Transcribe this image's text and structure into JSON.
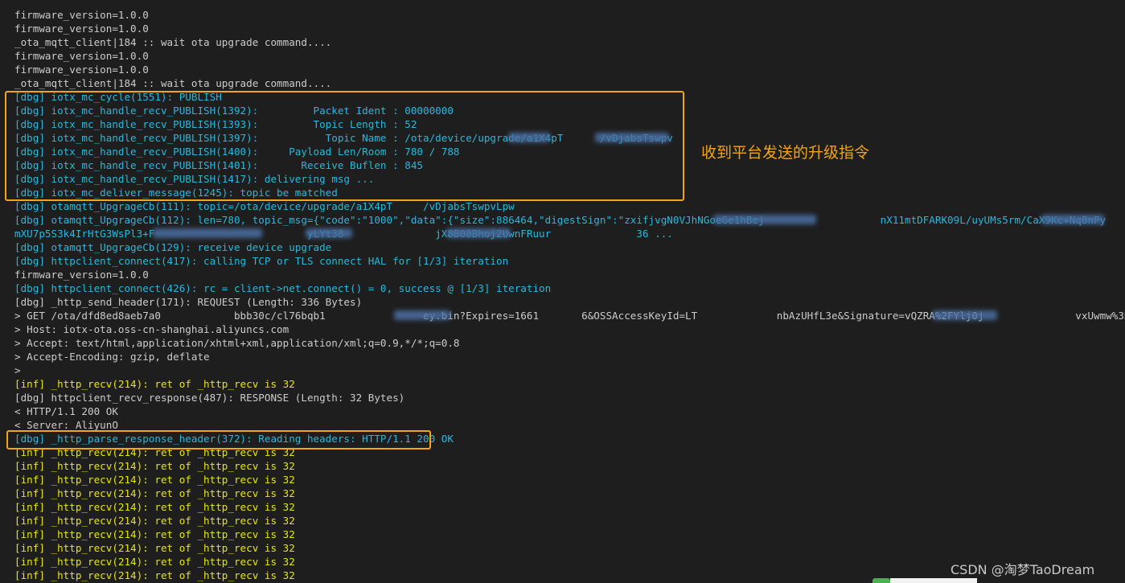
{
  "terminal": {
    "lines": [
      {
        "text": "firmware_version=1.0.0",
        "color": "white"
      },
      {
        "text": "firmware_version=1.0.0",
        "color": "white"
      },
      {
        "text": "_ota_mqtt_client|184 :: wait ota upgrade command....",
        "color": "white"
      },
      {
        "text": "firmware_version=1.0.0",
        "color": "white"
      },
      {
        "text": "firmware_version=1.0.0",
        "color": "white"
      },
      {
        "text": "_ota_mqtt_client|184 :: wait ota upgrade command....",
        "color": "white"
      },
      {
        "text": "[dbg] iotx_mc_cycle(1551): PUBLISH",
        "color": "cyan"
      },
      {
        "text": "[dbg] iotx_mc_handle_recv_PUBLISH(1392):         Packet Ident : 00000000",
        "color": "cyan"
      },
      {
        "text": "[dbg] iotx_mc_handle_recv_PUBLISH(1393):         Topic Length : 52",
        "color": "cyan"
      },
      {
        "text": "[dbg] iotx_mc_handle_recv_PUBLISH(1397):           Topic Name : /ota/device/upgrade/a1X4pT      /vDjabsTswpv",
        "color": "cyan"
      },
      {
        "text": "[dbg] iotx_mc_handle_recv_PUBLISH(1400):     Payload Len/Room : 780 / 788",
        "color": "cyan"
      },
      {
        "text": "[dbg] iotx_mc_handle_recv_PUBLISH(1401):       Receive Buflen : 845",
        "color": "cyan"
      },
      {
        "text": "[dbg] iotx_mc_handle_recv_PUBLISH(1417): delivering msg ...",
        "color": "cyan"
      },
      {
        "text": "[dbg] iotx_mc_deliver_message(1245): topic be matched",
        "color": "cyan"
      },
      {
        "text": "[dbg] otamqtt_UpgrageCb(111): topic=/ota/device/upgrade/a1X4pT     /vDjabsTswpvLpw",
        "color": "cyan"
      },
      {
        "text": "[dbg] otamqtt_UpgrageCb(112): len=780, topic_msg={\"code\":\"1000\",\"data\":{\"size\":886464,\"digestSign\":\"zxifjvgN0VJhNGoeGe1hBej                   nX11mtDFARK09L/uyUMs5rm/CaX9Kc+Nq8nPy              3N/PB6mk8",
        "color": "cyan"
      },
      {
        "text": "mXU7p5S3k4IrHtG3WsPl3+F                         yLYt38               jX8B08Bhoj2UwnFRuur              36 ...",
        "color": "cyan"
      },
      {
        "text": "[dbg] otamqtt_UpgrageCb(129): receive device upgrade",
        "color": "cyan"
      },
      {
        "text": "[dbg] httpclient_connect(417): calling TCP or TLS connect HAL for [1/3] iteration",
        "color": "cyan"
      },
      {
        "text": "firmware_version=1.0.0",
        "color": "white"
      },
      {
        "text": "[dbg] httpclient_connect(426): rc = client->net.connect() = 0, success @ [1/3] iteration",
        "color": "cyan"
      },
      {
        "text": "[dbg] _http_send_header(171): REQUEST (Length: 336 Bytes)",
        "color": "white"
      },
      {
        "text": "> GET /ota/dfd8ed8aeb7a0            bbb30c/cl76bqb1                ey.bin?Expires=1661       6&OSSAccessKeyId=LT             nbAzUHfL3e&Signature=vQZRA%2FYlj0j               vxUwmw%3D HTTP/1.1",
        "color": "white"
      },
      {
        "text": "> Host: iotx-ota.oss-cn-shanghai.aliyuncs.com",
        "color": "white"
      },
      {
        "text": "> Accept: text/html,application/xhtml+xml,application/xml;q=0.9,*/*;q=0.8",
        "color": "white"
      },
      {
        "text": "> Accept-Encoding: gzip, deflate",
        "color": "white"
      },
      {
        "text": ">",
        "color": "white"
      },
      {
        "text": "[inf] _http_recv(214): ret of _http_recv is 32",
        "color": "yellow"
      },
      {
        "text": "[dbg] httpclient_recv_response(487): RESPONSE (Length: 32 Bytes)",
        "color": "white"
      },
      {
        "text": "< HTTP/1.1 200 OK",
        "color": "white"
      },
      {
        "text": "< Server: AliyunO",
        "color": "white"
      },
      {
        "text": "[dbg] _http_parse_response_header(372): Reading headers: HTTP/1.1 200 OK",
        "color": "cyan"
      },
      {
        "text": "[inf] _http_recv(214): ret of _http_recv is 32",
        "color": "yellow"
      },
      {
        "text": "[inf] _http_recv(214): ret of _http_recv is 32",
        "color": "yellow"
      },
      {
        "text": "[inf] _http_recv(214): ret of _http_recv is 32",
        "color": "yellow"
      },
      {
        "text": "[inf] _http_recv(214): ret of _http_recv is 32",
        "color": "yellow"
      },
      {
        "text": "[inf] _http_recv(214): ret of _http_recv is 32",
        "color": "yellow"
      },
      {
        "text": "[inf] _http_recv(214): ret of _http_recv is 32",
        "color": "yellow"
      },
      {
        "text": "[inf] _http_recv(214): ret of _http_recv is 32",
        "color": "yellow"
      },
      {
        "text": "[inf] _http_recv(214): ret of _http_recv is 32",
        "color": "yellow"
      },
      {
        "text": "[inf] _http_recv(214): ret of _http_recv is 32",
        "color": "yellow"
      },
      {
        "text": "[inf] _http_recv(214): ret of _http_recv is 32",
        "color": "yellow"
      }
    ]
  },
  "annotation": {
    "text": "收到平台发送的升级指令"
  },
  "watermark": {
    "text": "CSDN @淘梦TaoDream"
  },
  "colors": {
    "background": "#1e1e1e",
    "white": "#cccccc",
    "cyan": "#29b8db",
    "yellow": "#e5e510",
    "highlight": "#f2a516"
  }
}
